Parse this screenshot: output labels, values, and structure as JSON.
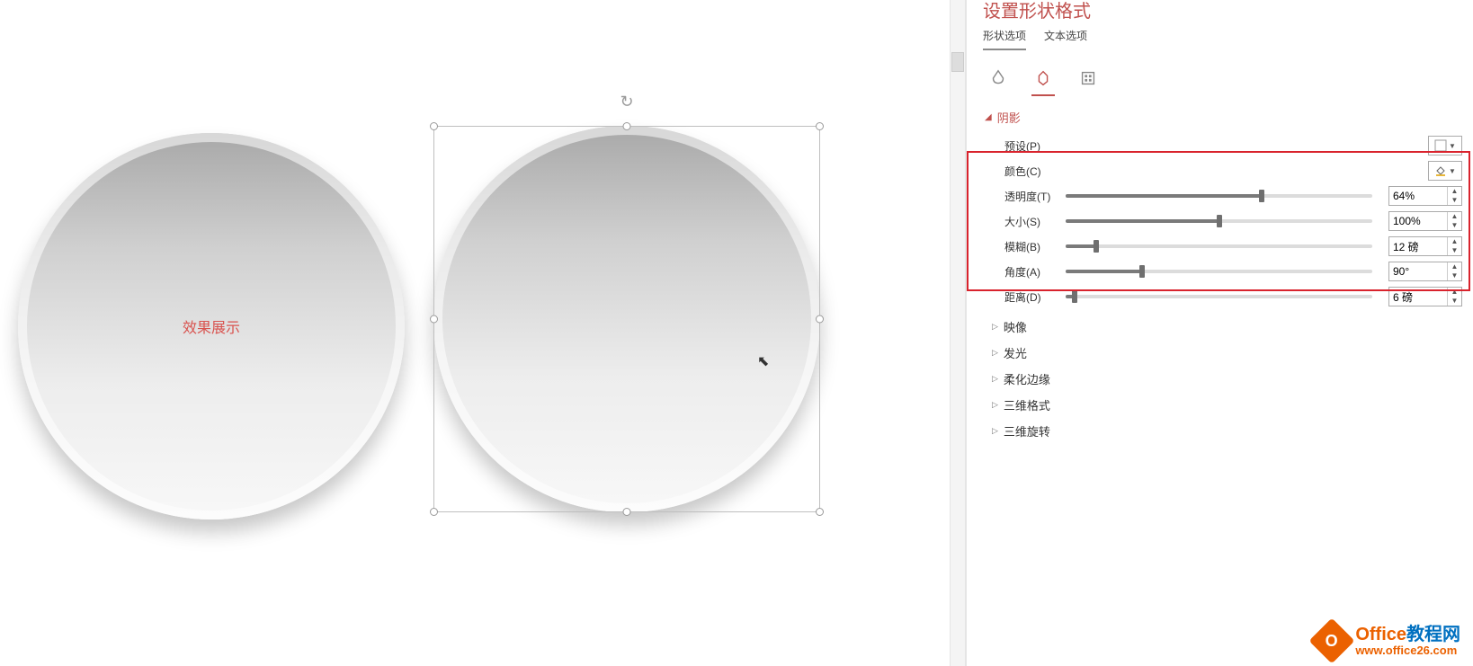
{
  "canvas": {
    "left_circle_label": "效果展示"
  },
  "panel": {
    "title": "设置形状格式",
    "tabs": {
      "shape": "形状选项",
      "text": "文本选项"
    },
    "icons": {
      "fill": "fill-line-icon",
      "effects": "effects-icon",
      "size": "size-properties-icon"
    },
    "shadow": {
      "header": "阴影",
      "preset_label": "预设(P)",
      "color_label": "颜色(C)",
      "transparency": {
        "label": "透明度(T)",
        "value": "64%",
        "pct": 64
      },
      "size": {
        "label": "大小(S)",
        "value": "100%",
        "pct": 50
      },
      "blur": {
        "label": "模糊(B)",
        "value": "12 磅",
        "pct": 10
      },
      "angle": {
        "label": "角度(A)",
        "value": "90°",
        "pct": 25
      },
      "distance": {
        "label": "距离(D)",
        "value": "6 磅",
        "pct": 3
      }
    },
    "sections": {
      "reflection": "映像",
      "glow": "发光",
      "soft_edges": "柔化边缘",
      "format_3d": "三维格式",
      "rotation_3d": "三维旋转"
    }
  },
  "watermark": {
    "line1_a": "Office",
    "line1_b": "教程网",
    "line2": "www.office26.com"
  }
}
